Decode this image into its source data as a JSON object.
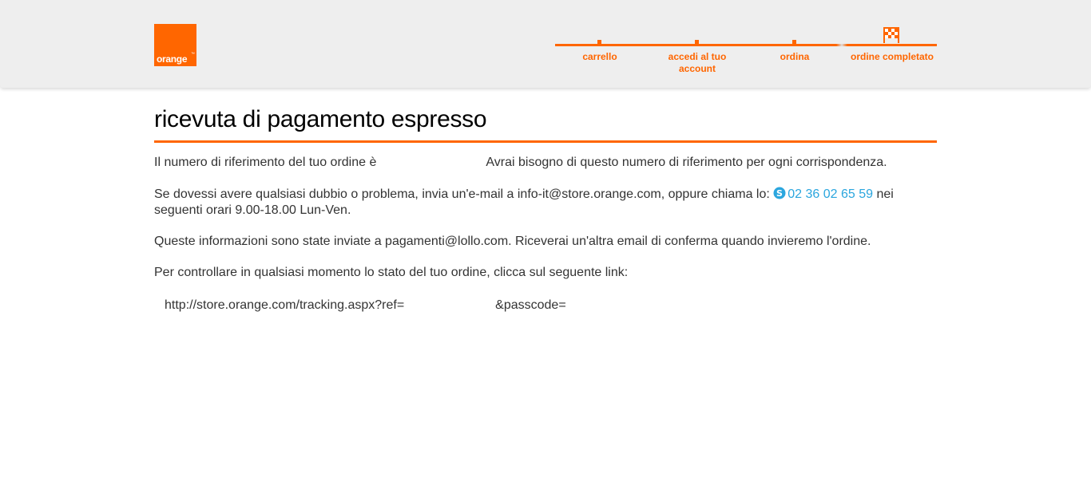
{
  "brand": {
    "logo_text": "orange",
    "logo_tm": "™",
    "color": "#ff6600"
  },
  "steps": [
    {
      "label": "carrello"
    },
    {
      "label": "accedi al tuo account"
    },
    {
      "label": "ordina"
    },
    {
      "label": "ordine completato",
      "icon": "checkered-flag-icon"
    }
  ],
  "main": {
    "title": "ricevuta di pagamento espresso",
    "order_ref_text": "Il numero di riferimento del tuo ordine è",
    "order_ref_note": "Avrai bisogno di questo numero di riferimento per ogni corrispondenza.",
    "help_text": "Se dovessi avere qualsiasi dubbio o problema, invia un'e-mail a info-it@store.orange.com, oppure chiama lo:",
    "phone": "02 36 02 65 59",
    "help_text_end": "nei seguenti orari 9.00-18.00 Lun-Ven.",
    "info_sent_text": "Queste informazioni sono state inviate a pagamenti@lollo.com. Riceverai un'altra email di conferma quando invieremo l'ordine.",
    "tracking_intro": "Per controllare in qualsiasi momento lo stato del tuo ordine, clicca sul seguente link:",
    "tracking_url": "http://store.orange.com/tracking.aspx?ref=",
    "tracking_passcode": "&passcode=",
    "link_color": "#2ba6de"
  }
}
